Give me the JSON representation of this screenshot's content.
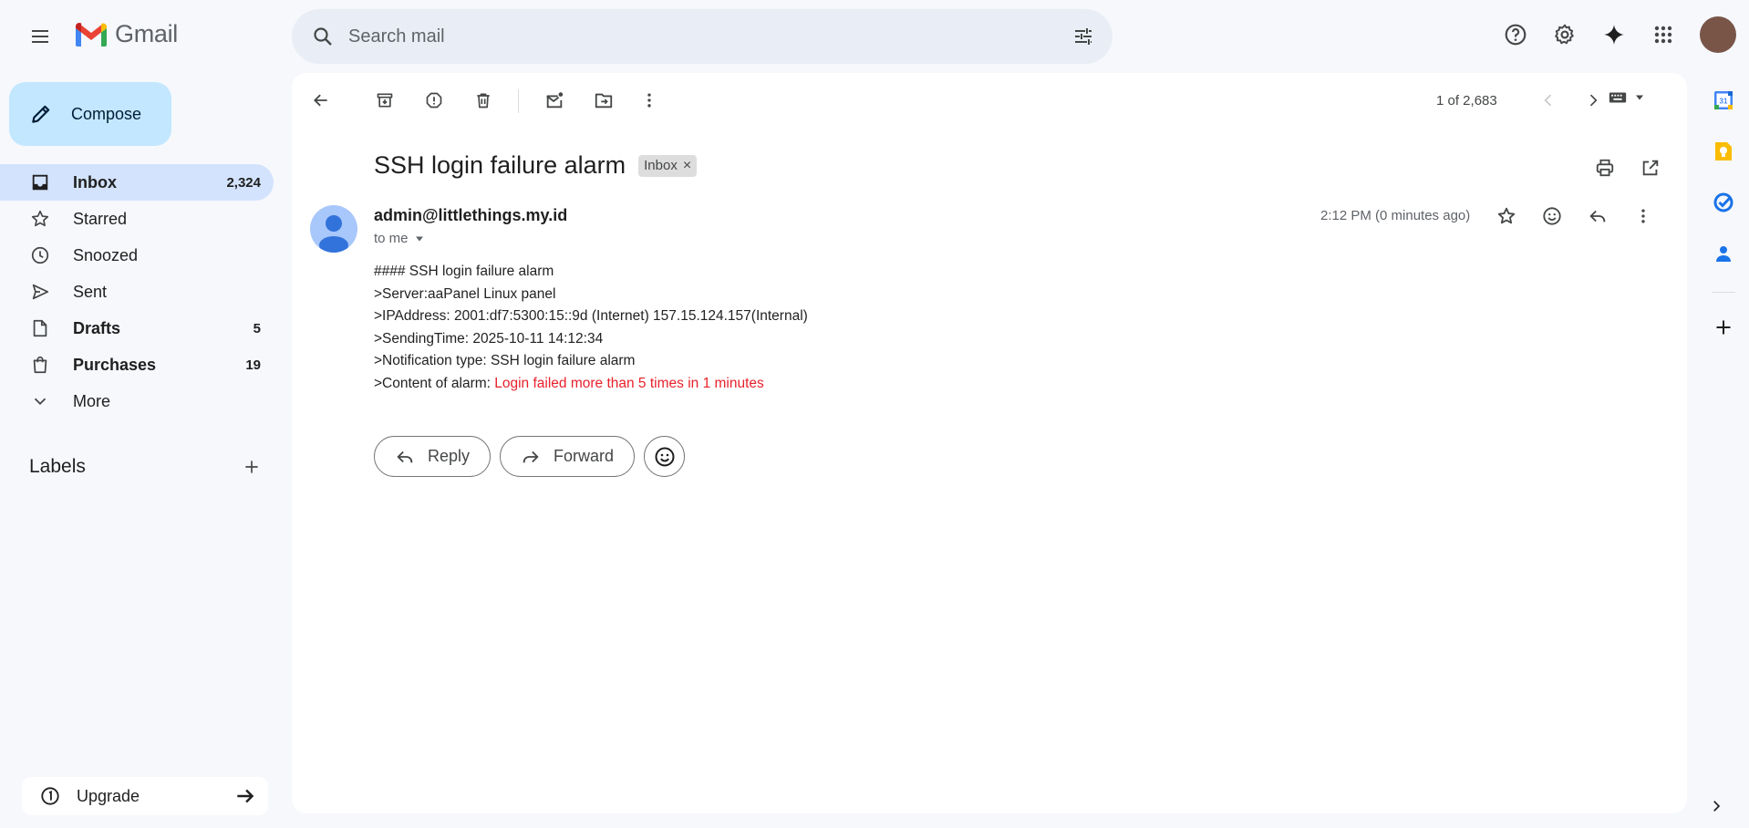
{
  "app": {
    "name": "Gmail"
  },
  "search": {
    "placeholder": "Search mail"
  },
  "compose": {
    "label": "Compose"
  },
  "nav": {
    "items": [
      {
        "label": "Inbox",
        "count": "2,324"
      },
      {
        "label": "Starred",
        "count": ""
      },
      {
        "label": "Snoozed",
        "count": ""
      },
      {
        "label": "Sent",
        "count": ""
      },
      {
        "label": "Drafts",
        "count": "5"
      },
      {
        "label": "Purchases",
        "count": "19"
      },
      {
        "label": "More",
        "count": ""
      }
    ]
  },
  "labels": {
    "title": "Labels"
  },
  "upgrade": {
    "label": "Upgrade"
  },
  "pager": {
    "text": "1 of 2,683"
  },
  "email": {
    "subject": "SSH login failure alarm",
    "chip": "Inbox",
    "chip_close": "×",
    "sender": "admin@littlethings.my.id",
    "to": "to me",
    "time": "2:12 PM (0 minutes ago)",
    "body": [
      "#### SSH login failure alarm",
      ">Server:aaPanel Linux panel",
      ">IPAddress: 2001:df7:5300:15::9d (Internet) 157.15.124.157(Internal)",
      ">SendingTime: 2025-10-11 14:12:34",
      ">Notification type: SSH login failure alarm"
    ],
    "content_prefix": ">Content of alarm: ",
    "content_alarm": "Login failed more than 5 times in 1 minutes"
  },
  "actions": {
    "reply": "Reply",
    "forward": "Forward"
  },
  "calendar": {
    "day": "31"
  },
  "colors": {
    "accent": "#0b57d0",
    "compose_bg": "#c2e7ff",
    "active_nav": "#d3e3fd",
    "alarm_text": "#e8202b",
    "page_bg": "#f6f8fc"
  }
}
